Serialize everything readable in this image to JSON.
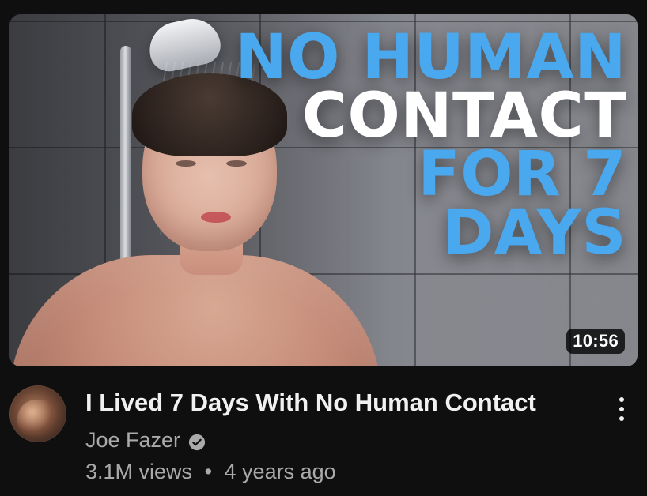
{
  "video": {
    "duration": "10:56",
    "thumbnail_text": {
      "line1": "NO HUMAN",
      "line2": "CONTACT",
      "line3": "FOR 7 DAYS"
    },
    "title": "I Lived 7 Days With No Human Contact",
    "channel": "Joe Fazer",
    "views": "3.1M views",
    "separator": "•",
    "age": "4 years ago"
  },
  "icons": {
    "verified": "verified-check-icon",
    "menu": "more-vertical-icon"
  },
  "colors": {
    "background": "#0f0f0f",
    "primary_text": "#f1f1f1",
    "secondary_text": "#aaaaaa",
    "thumbnail_blue": "#4aa8ee"
  }
}
